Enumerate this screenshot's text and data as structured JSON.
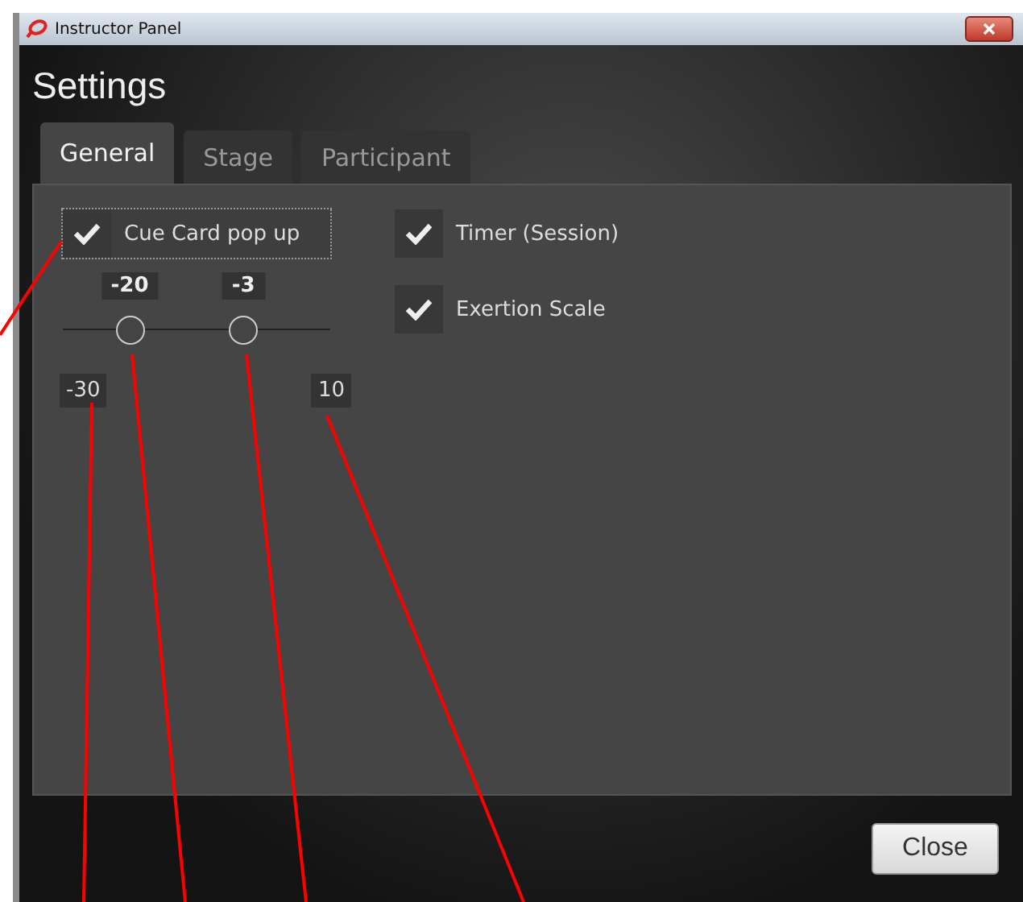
{
  "window": {
    "title": "Instructor Panel"
  },
  "heading": "Settings",
  "tabs": [
    {
      "label": "General",
      "selected": true
    },
    {
      "label": "Stage",
      "selected": false
    },
    {
      "label": "Participant",
      "selected": false
    }
  ],
  "options_left": [
    {
      "label": "Cue Card pop up",
      "checked": true,
      "focused": true
    }
  ],
  "slider": {
    "min_label": "-30",
    "max_label": "10",
    "thumbs": [
      {
        "value": "-20",
        "level": 0.25
      },
      {
        "value": "-3",
        "level": 0.675
      }
    ]
  },
  "options_right": [
    {
      "label": "Timer (Session)",
      "checked": true,
      "focused": false
    },
    {
      "label": "Exertion Scale",
      "checked": true,
      "focused": false
    }
  ],
  "buttons": [
    {
      "label": "Close"
    }
  ]
}
